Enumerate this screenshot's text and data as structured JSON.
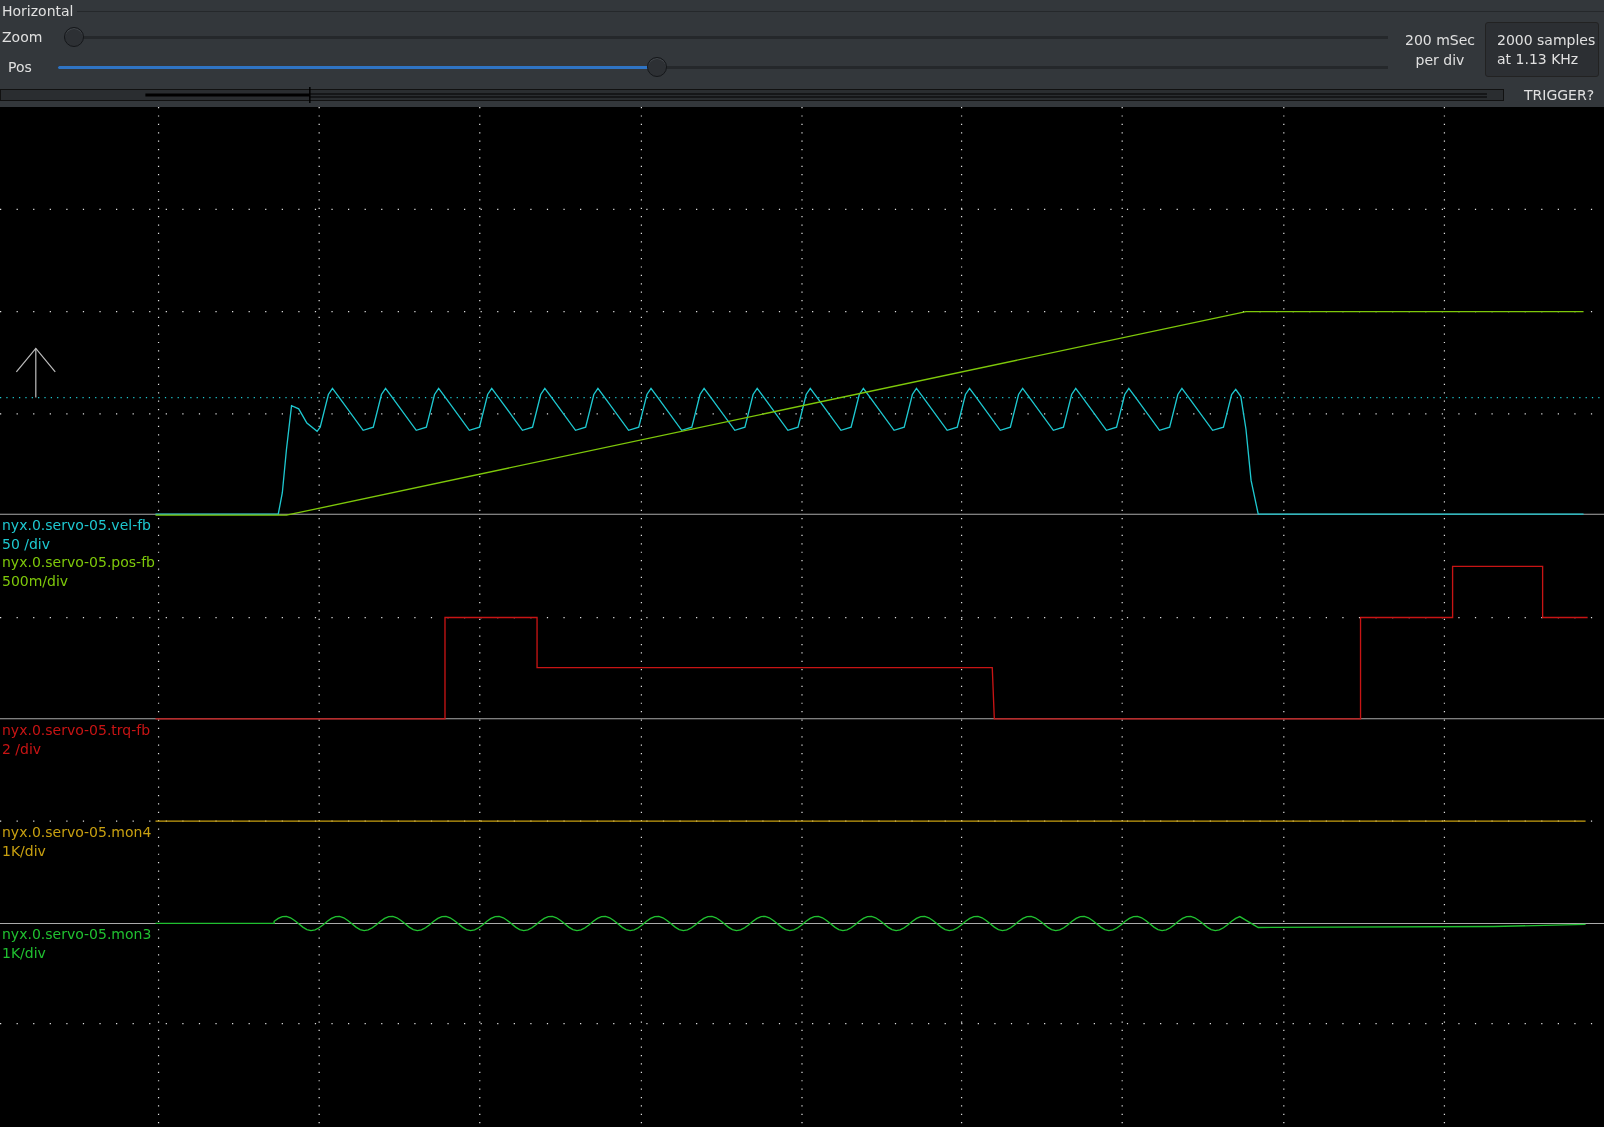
{
  "horizontal": {
    "title": "Horizontal",
    "zoom": {
      "label": "Zoom",
      "level": 0
    },
    "pos": {
      "label": "Pos",
      "level": 0.45
    },
    "timebase": [
      "200 mSec",
      "per div"
    ],
    "samples_button": [
      "2000 samples",
      "at 1.13 KHz"
    ],
    "trigger_status": "TRIGGER?"
  },
  "channels": [
    {
      "name": "nyx.0.servo-05.vel-fb",
      "scale": "50 /div",
      "color": "#1ec8d0"
    },
    {
      "name": "nyx.0.servo-05.pos-fb",
      "scale": "500m/div",
      "color": "#7ec80a"
    },
    {
      "name": "nyx.0.servo-05.trq-fb",
      "scale": "2 /div",
      "color": "#c81414"
    },
    {
      "name": "nyx.0.servo-05.mon4",
      "scale": "1K/div",
      "color": "#c8a010"
    },
    {
      "name": "nyx.0.servo-05.mon3",
      "scale": "1K/div",
      "color": "#20c030"
    }
  ]
}
